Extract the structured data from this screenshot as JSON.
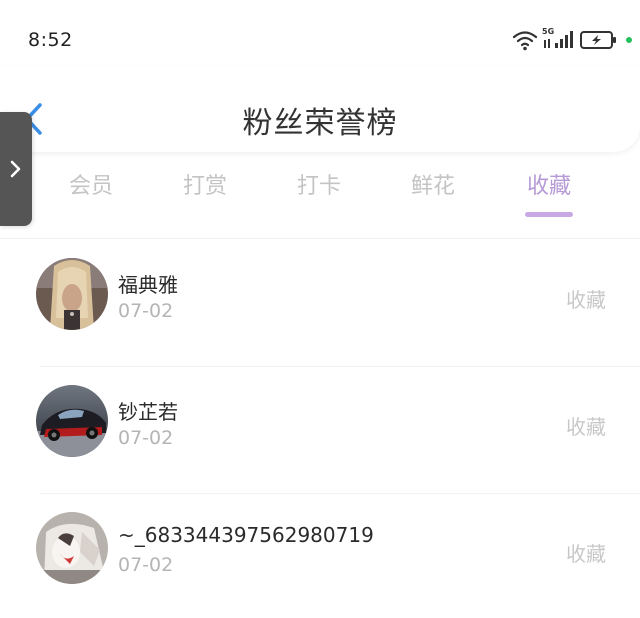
{
  "status_bar": {
    "time": "8:52",
    "network_label": "5G",
    "icons": [
      "wifi-icon",
      "signal-icon",
      "battery-charging-icon",
      "status-dot-icon"
    ],
    "colors": {
      "status_dot": "#24c15b"
    }
  },
  "header": {
    "title": "粉丝荣誉榜",
    "back_icon": "chevron-left-icon",
    "back_color": "#3a8ee6"
  },
  "side_tab": {
    "icon": "chevron-right-icon"
  },
  "tabs": [
    {
      "label": "会员",
      "active": false
    },
    {
      "label": "打赏",
      "active": false
    },
    {
      "label": "打卡",
      "active": false
    },
    {
      "label": "鲜花",
      "active": false
    },
    {
      "label": "收藏",
      "active": true
    }
  ],
  "colors": {
    "active_tab": "#b69ad6",
    "inactive_tab": "#c4c4c4"
  },
  "list": {
    "items": [
      {
        "name": "福典雅",
        "date": "07-02",
        "action": "收藏",
        "avatar": "avatar-blonde-hair"
      },
      {
        "name": "钞芷若",
        "date": "07-02",
        "action": "收藏",
        "avatar": "avatar-sports-car"
      },
      {
        "name": "~_683344397562980719",
        "date": "07-02",
        "action": "收藏",
        "avatar": "avatar-plush-toy"
      }
    ]
  }
}
